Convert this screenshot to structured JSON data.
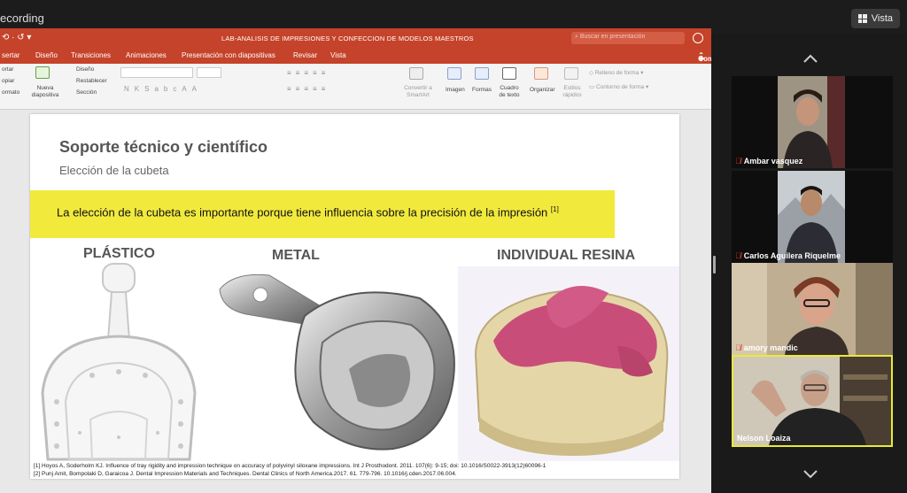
{
  "topbar": {
    "recording_label": "ecording",
    "view_button": "Vista"
  },
  "powerpoint": {
    "document_title": "LAB-ANALISIS DE IMPRESIONES Y CONFECCION DE MODELOS MAESTROS",
    "search_placeholder": "Buscar en presentación",
    "share_label": "Compartir",
    "tabs": [
      "sertar",
      "Diseño",
      "Transiciones",
      "Animaciones",
      "Presentación con diapositivas",
      "Revisar",
      "Vista"
    ],
    "ribbon": {
      "clipboard": [
        "ortar",
        "opiar",
        "ormato"
      ],
      "new_slide": "Nueva diapositiva",
      "slide_options": [
        "Diseño",
        "Restablecer",
        "Sección"
      ],
      "convert_smartart": "Convertir a SmartArt",
      "image": "Imagen",
      "shapes": "Formas",
      "textbox": "Cuadro de texto",
      "arrange": "Organizar",
      "quick_styles": "Estilos rápidos",
      "shape_fill": "Relleno de forma",
      "shape_outline": "Contorno de forma"
    }
  },
  "slide": {
    "title": "Soporte técnico y científico",
    "subtitle": "Elección de la cubeta",
    "highlight_text": "La elección de la cubeta es importante porque tiene influencia sobre la precisión de la impresión",
    "highlight_ref": "[1]",
    "label_plastic": "PLÁSTICO",
    "label_metal": "METAL",
    "label_resin": "INDIVIDUAL RESINA",
    "reference_1": "[1] Hoyos A, Soderholm KJ. Influence of tray rigidity and impression technique on accuracy of polyvinyl siloxane impressions. Int J Prosthodont. 2011. 107(6): 9-15; doi: 10.1016/S0022-3913(12)60096-1",
    "reference_2": "[2] Punj Amit, Bompolaki D, Garaicoa J. Dental Impression Materials and Techniques. Dental Clinics of North America.2017. 61. 779-796. 10.1016/j.cden.2017.06.004."
  },
  "participants": [
    {
      "name": "Ambar vasquez"
    },
    {
      "name": "Carlos Aguilera Riquelme"
    },
    {
      "name": "amory mandic"
    },
    {
      "name": "Nelson Loaiza"
    }
  ],
  "colors": {
    "ppt_accent": "#c5432a",
    "highlight_yellow": "#f2e93d",
    "active_speaker_border": "#e9e93a",
    "muted_mic": "#e03a2f"
  }
}
